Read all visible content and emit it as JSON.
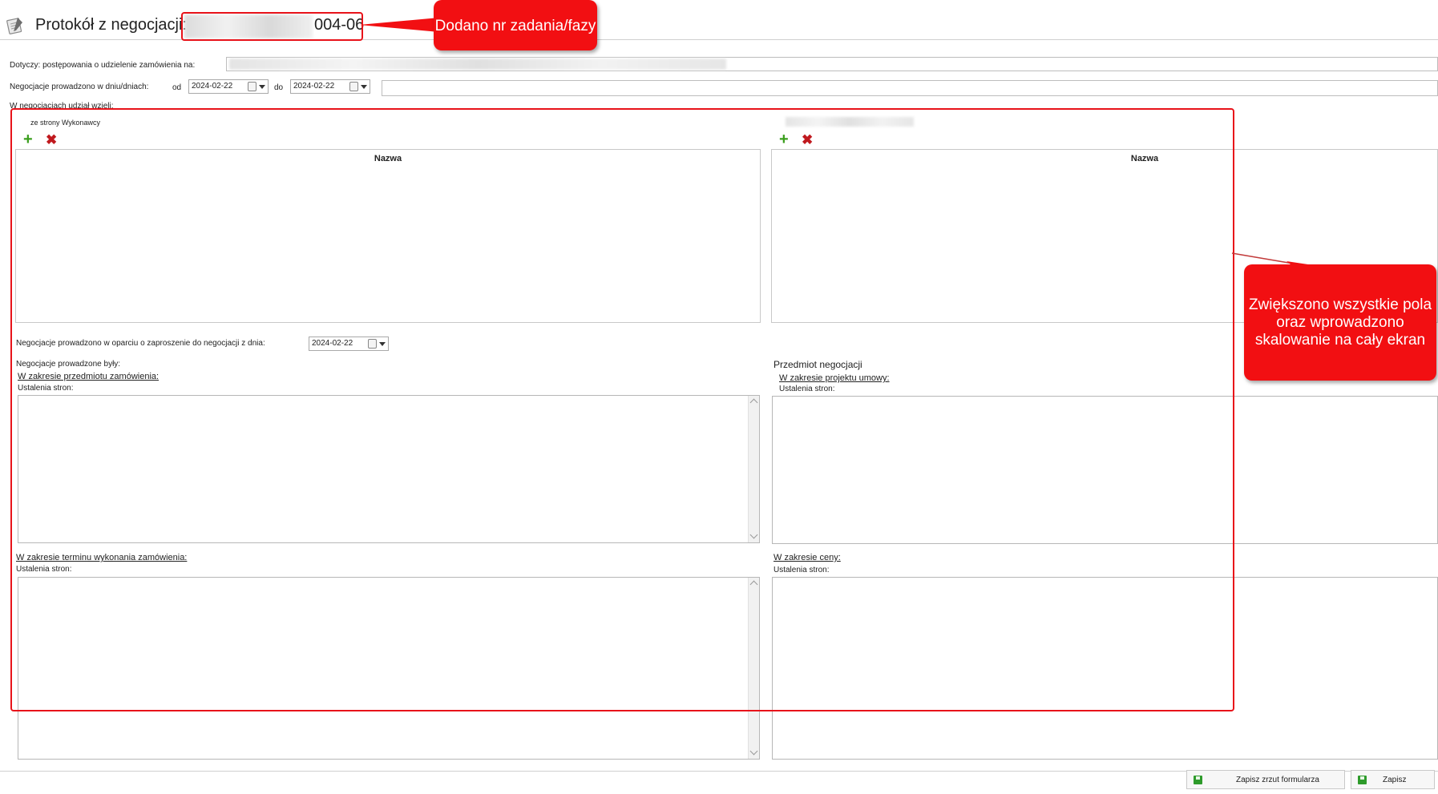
{
  "window": {
    "title_prefix": "Protokół z negocjacji:",
    "title_suffix": "004-06"
  },
  "annotations": {
    "callout_top": "Dodano nr zadania/fazy",
    "callout_right": "Zwiększono wszystkie pola oraz wprowadzono skalowanie na cały ekran",
    "color": "#f20f12"
  },
  "form": {
    "dotyczy_label": "Dotyczy: postępowania o udzielenie zamówienia na:",
    "negocjacje_daty_label": "Negocjacje prowadzono w dniu/dniach:",
    "od_label": "od",
    "od_value": "2024-02-22",
    "do_label": "do",
    "do_value": "2024-02-22",
    "udzial_label": "W negocjacjach udział wzięli:",
    "wykonawca_label": "ze strony Wykonawcy",
    "left_grid_header": "Nazwa",
    "right_grid_header": "Nazwa",
    "zaproszenie_label": "Negocjacje prowadzono w oparciu o zaproszenie do negocjacji z dnia:",
    "zaproszenie_value": "2024-02-22",
    "prowadzone_byly_label": "Negocjacje prowadzone były:",
    "przedmiot_label": "Przedmiot negocjacji",
    "zakres_przedmiotu_label": "W zakresie przedmiotu zamówienia:",
    "zakres_projektu_label": "W zakresie projektu umowy:",
    "zakres_terminu_label": "W zakresie terminu wykonania zamówienia:",
    "zakres_ceny_label": "W zakresie ceny:",
    "ustalenia_label": "Ustalenia stron:"
  },
  "buttons": {
    "zapisz_zrzut": "Zapisz zrzut formularza",
    "zapisz": "Zapisz"
  },
  "icons": {
    "add": "plus-icon",
    "remove": "x-icon",
    "save": "floppy-icon",
    "document": "notepad-icon"
  }
}
